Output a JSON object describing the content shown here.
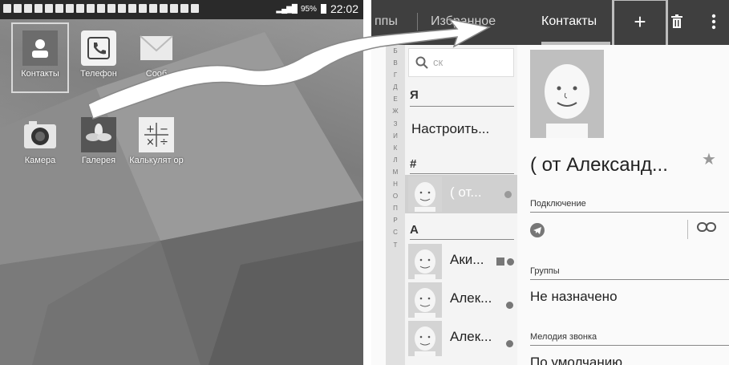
{
  "status_bar": {
    "battery_percent": "95%",
    "time": "22:02"
  },
  "home_apps": [
    {
      "label": "Контакты",
      "icon": "contacts-icon"
    },
    {
      "label": "Телефон",
      "icon": "phone-icon"
    },
    {
      "label": "Сооб",
      "icon": "messages-icon"
    },
    {
      "label": "Камера",
      "icon": "camera-icon"
    },
    {
      "label": "Галерея",
      "icon": "gallery-icon"
    },
    {
      "label": "Калькулят ор",
      "icon": "calculator-icon"
    }
  ],
  "contacts_app": {
    "tabs": [
      "ппы",
      "Избранное",
      "Контакты"
    ],
    "actions": {
      "add": "+",
      "delete_icon": "trash-icon",
      "more_icon": "more-vertical-icon"
    },
    "index_letters": [
      "Б",
      "В",
      "Г",
      "Д",
      "Е",
      "Ж",
      "З",
      "И",
      "К",
      "Л",
      "М",
      "Н",
      "О",
      "П",
      "Р",
      "С",
      "Т"
    ],
    "search_placeholder": "ск",
    "sections": {
      "me": "Я",
      "hash": "#",
      "a": "А"
    },
    "setup_label": "Настроить...",
    "rows": [
      {
        "name": "( от..."
      },
      {
        "name": "Аки..."
      },
      {
        "name": "Алек..."
      },
      {
        "name": "Алек..."
      }
    ],
    "detail": {
      "name": "( от Александ...",
      "connection_label": "Подключение",
      "groups_label": "Группы",
      "groups_value": "Не назначено",
      "ringtone_label": "Мелодия звонка",
      "ringtone_value": "По умолчанию"
    }
  },
  "colors": {
    "status_bar": "#2a2a2a",
    "action_bar": "#3f3f3f",
    "selected_row": "#d0d0d0"
  }
}
